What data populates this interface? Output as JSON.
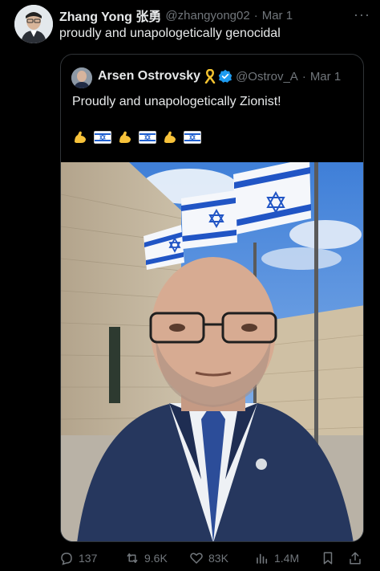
{
  "tweet": {
    "author_name": "Zhang Yong 张勇",
    "handle": "@zhangyong02",
    "separator": "·",
    "date": "Mar 1",
    "more": "···",
    "text": "proudly and unapologetically genocidal"
  },
  "quote": {
    "author_name": "Arsen Ostrovsky",
    "handle": "@Ostrov_A",
    "separator": "·",
    "date": "Mar 1",
    "text": "Proudly and unapologetically Zionist!",
    "emojis": [
      "flexed-biceps",
      "israel-flag",
      "flexed-biceps",
      "israel-flag",
      "flexed-biceps",
      "israel-flag"
    ],
    "photo_description": "selfie in front of building with flags"
  },
  "actions": {
    "replies": "137",
    "reposts": "9.6K",
    "likes": "83K",
    "views": "1.4M"
  },
  "colors": {
    "background": "#000000",
    "text": "#e7e9ea",
    "muted": "#71767b",
    "verified": "#1d9bf0",
    "flag_blue": "#1f5fcf"
  }
}
